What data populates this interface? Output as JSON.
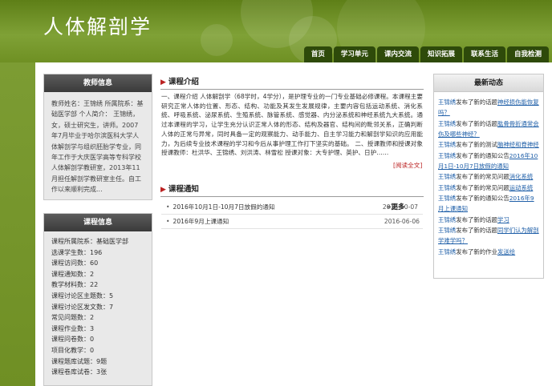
{
  "site": {
    "title": "人体解剖学"
  },
  "nav": [
    {
      "label": "首页"
    },
    {
      "label": "学习单元"
    },
    {
      "label": "课内交流"
    },
    {
      "label": "知识拓展"
    },
    {
      "label": "联系生活"
    },
    {
      "label": "自我检测"
    }
  ],
  "teacher": {
    "heading": "教师信息",
    "text": "教师姓名：王锦绣 所属院系：基础医学部 个人简介： 王锦绣，女，硕士研究生，讲师。2007年7月毕业于哈尔滨医科大学人体解剖学与组织胚胎学专业，同年工作于大庆医学高等专科学校人体解剖学教研室，2013年11月担任解剖学教研室主任。自工作以来顺利完成..."
  },
  "course": {
    "heading": "课程信息",
    "stats": [
      "课程所属院系：基础医学部",
      "选课学生数：196",
      "课程访问数：60",
      "课程通知数：2",
      "教学材料数：22",
      "课程讨论区主题数：5",
      "课程讨论区发文数：7",
      "常见问题数：2",
      "课程作业数：3",
      "课程问卷数：0",
      "项目化教学：0",
      "课程题库试题：9题",
      "课程卷库试卷：3张"
    ]
  },
  "intro": {
    "heading": "课程介绍",
    "text": "一、课程介绍 人体解剖学（68学时，4学分），是护理专业的一门专业基础必修课程。本课程主要研究正常人体的位置、形态、结构、功能及其发生发展规律，主要内容包括运动系统、消化系统、呼吸系统、泌尿系统、生殖系统、脉管系统、感觉器、内分泌系统和神经系统九大系统。通过本课程的学习，让学生充分认识正常人体的形态、结构及器官、结构间的毗邻关系，正确判断人体的正常与异常，同时具备一定的观察能力、动手能力、自主学习能力和解剖学知识的应用能力，为后续专业技术课程的学习和今后从事护理工作打下坚实的基础。 二、授课教师和授课对象 授课教师：杜洪华、王锦绣、刘洪涛、林雪松 授课对象：大专护理、英护、日护……",
    "read_more": "[阅读全文]"
  },
  "notices": {
    "heading": "课程通知",
    "more": "更多",
    "items": [
      {
        "title": "2016年10月1日-10月7日放假的通知",
        "date": "2016-10-07"
      },
      {
        "title": "2016年9月上课通知",
        "date": "2016-06-06"
      }
    ]
  },
  "news": {
    "heading": "最新动态",
    "items": [
      {
        "who": "王锦绣",
        "action": "发布了新的话题",
        "link": "神经损伤能恢复吗？"
      },
      {
        "who": "王锦绣",
        "action": "发布了新的话题",
        "link": "肱骨骨折通常会伤及哪些神经？"
      },
      {
        "who": "王锦绣",
        "action": "发布了新的测试",
        "link": "脑神经和脊神经"
      },
      {
        "who": "王锦绣",
        "action": "发布了新的通知公告",
        "link": "2016年10月1日-10月7日放假的通知"
      },
      {
        "who": "王锦绣",
        "action": "发布了新的常见问题",
        "link": "消化系统"
      },
      {
        "who": "王锦绣",
        "action": "发布了新的常见问题",
        "link": "运动系统"
      },
      {
        "who": "王锦绣",
        "action": "发布了新的通知公告",
        "link": "2016年9月上课通知"
      },
      {
        "who": "王锦绣",
        "action": "发布了新的话题",
        "link": "学习"
      },
      {
        "who": "王锦绣",
        "action": "发布了新的话题",
        "link": "同学们认为解剖学难学吗？"
      },
      {
        "who": "王锦绣",
        "action": "发布了新的作业",
        "link": "发送给"
      }
    ]
  }
}
